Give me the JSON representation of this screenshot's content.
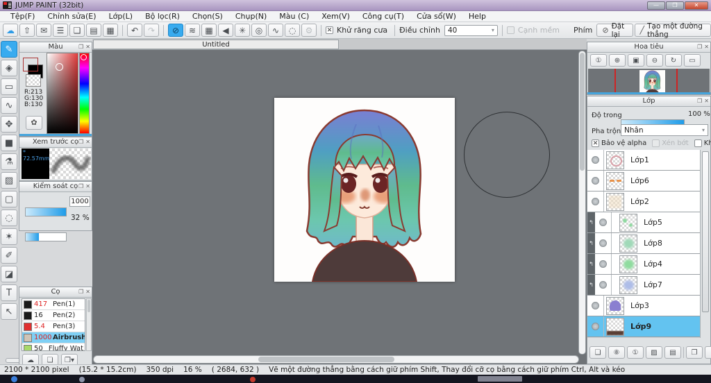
{
  "window": {
    "title": "JUMP PAINT (32bit)",
    "minimize": "—",
    "restore": "❐",
    "close": "✕"
  },
  "menubar": {
    "items": [
      "Tệp(F)",
      "Chỉnh sửa(E)",
      "Lớp(L)",
      "Bộ lọc(R)",
      "Chọn(S)",
      "Chụp(N)",
      "Màu (C)",
      "Xem(V)",
      "Công cụ(T)",
      "Cửa sổ(W)",
      "Help"
    ]
  },
  "toolbar": {
    "file_group": [
      {
        "n": "cloud-sync-button",
        "g": "☁",
        "c": "#2e9be6"
      },
      {
        "n": "export-button",
        "g": "⇧"
      },
      {
        "n": "comment-button",
        "g": "✉"
      },
      {
        "n": "chat-button",
        "g": "☰"
      },
      {
        "n": "document-button",
        "g": "❏"
      },
      {
        "n": "material-panel-button",
        "g": "▤"
      },
      {
        "n": "pixel-edit-button",
        "g": "▦"
      }
    ],
    "undo_group": [
      {
        "n": "undo-button",
        "g": "↶"
      },
      {
        "n": "redo-button",
        "g": "↷",
        "dis": true
      }
    ],
    "ruler_group": [
      {
        "n": "ruler-off-button",
        "g": "⊘",
        "sel": true
      },
      {
        "n": "parallel-ruler-button",
        "g": "≋"
      },
      {
        "n": "grid-ruler-button",
        "g": "▦"
      },
      {
        "n": "vanishing-ruler-button",
        "g": "◀"
      },
      {
        "n": "radial-ruler-button",
        "g": "✳"
      },
      {
        "n": "concentric-ruler-button",
        "g": "◎"
      },
      {
        "n": "curve-ruler-button",
        "g": "∿"
      },
      {
        "n": "ellipse-ruler-button",
        "g": "◌"
      },
      {
        "n": "ruler-settings-button",
        "g": "⚙",
        "dis": true
      }
    ],
    "antialias_label": "Khử răng cưa",
    "adjust_label": "Điều chỉnh",
    "adjust_value": "40",
    "soft_edge_label": "Cạnh mềm",
    "key_label": "Phím",
    "reset_button_label": "Đặt lại",
    "reset_button_glyph": "⊘",
    "line_button_label": "Tạo một đường thẳng",
    "line_button_glyph": "╱"
  },
  "tools": [
    {
      "n": "brush-tool",
      "g": "✎",
      "sel": true
    },
    {
      "n": "eraser-tool",
      "g": "◈"
    },
    {
      "n": "figure-tool",
      "g": "▭"
    },
    {
      "n": "snap-curve-tool",
      "g": "∿"
    },
    {
      "n": "move-tool",
      "g": "✥"
    },
    {
      "n": "fill-rect-tool",
      "g": "■"
    },
    {
      "n": "bucket-tool",
      "g": "⚗"
    },
    {
      "n": "gradient-tool",
      "g": "▨"
    },
    {
      "n": "select-rect-tool",
      "g": "▢"
    },
    {
      "n": "lasso-tool",
      "g": "◌"
    },
    {
      "n": "magic-wand-tool",
      "g": "✶"
    },
    {
      "n": "select-pen-tool",
      "g": "✐"
    },
    {
      "n": "select-eraser-tool",
      "g": "◪"
    },
    {
      "n": "text-tool",
      "g": "T"
    },
    {
      "n": "operate-tool",
      "g": "↖"
    }
  ],
  "panel_icons": {
    "popout": "❐",
    "close": "✕"
  },
  "color_panel": {
    "title": "Màu",
    "fg_color": "#d58282",
    "bg_color": "#000000",
    "rgb": [
      "R:213",
      "G:130",
      "B:130"
    ],
    "palette_glyph": "✿"
  },
  "brush_preview": {
    "title": "Xem trước cọ",
    "size_marker": "*",
    "size_text": "72.57mm"
  },
  "brush_control": {
    "title": "Kiểm soát cọ",
    "size_value": "1000",
    "size_percent": 100,
    "opacity_value": "32 %",
    "opacity_percent": 32
  },
  "brush_panel": {
    "title": "Cọ",
    "brushes": [
      {
        "color": "#1a1a1a",
        "size": "417",
        "red": true,
        "name": "Pen(1)"
      },
      {
        "color": "#1a1a1a",
        "size": "16",
        "red": false,
        "name": "Pen(2)"
      },
      {
        "color": "#e03030",
        "size": "5.4",
        "red": true,
        "name": "Pen(3)"
      },
      {
        "color": "#cfc4b6",
        "size": "1000",
        "red": true,
        "name": "Airbrush",
        "sel": true
      },
      {
        "color": "#a8d96a",
        "size": "50",
        "red": false,
        "name": "Fluffy Wat"
      }
    ],
    "buttons": [
      {
        "n": "brush-cloud-download-button",
        "g": "☁"
      },
      {
        "n": "brush-new-button",
        "g": "❏"
      },
      {
        "n": "brush-save-button",
        "g": "❒▾"
      }
    ]
  },
  "navigator": {
    "title": "Hoa tiêu",
    "buttons": [
      {
        "n": "zoom-actual-button",
        "g": "①"
      },
      {
        "n": "zoom-in-button",
        "g": "⊕"
      },
      {
        "n": "fit-screen-button",
        "g": "▣"
      },
      {
        "n": "zoom-out-button",
        "g": "⊖"
      },
      {
        "n": "rotate-view-button",
        "g": "↻"
      },
      {
        "n": "reset-view-button",
        "g": "▭"
      }
    ]
  },
  "layer_panel": {
    "title": "Lớp",
    "opacity_label": "Độ trong",
    "opacity_value": "100 %",
    "blend_label": "Pha trộn",
    "blend_value": "Nhân",
    "alpha_label": "Bảo vệ alpha",
    "clip_label": "Xén bớt",
    "lock_label": "Khóa",
    "clip_glyph": "↰",
    "layers": [
      {
        "name": "Lớp1",
        "shape": "scribble",
        "color": "#d9a0a8"
      },
      {
        "name": "Lớp6",
        "shape": "dashes",
        "color": "#e8924a"
      },
      {
        "name": "Lớp2",
        "shape": "wash",
        "color": "#f2dfc2"
      },
      {
        "name": "Lớp5",
        "shape": "dots",
        "color": "#8fd9a0",
        "clipped": true
      },
      {
        "name": "Lớp8",
        "shape": "blob",
        "color": "#a0d9b8",
        "clipped": true
      },
      {
        "name": "Lớp4",
        "shape": "blob",
        "color": "#8fdc9f",
        "clipped": true
      },
      {
        "name": "Lớp7",
        "shape": "blob",
        "color": "#aebde8",
        "clipped": true
      },
      {
        "name": "Lớp3",
        "shape": "arch",
        "color": "#8a7fd0"
      },
      {
        "name": "Lớp9",
        "shape": "strip",
        "color": "#5a3f35",
        "sel": true
      }
    ],
    "buttons": [
      {
        "n": "add-layer-button",
        "g": "❏"
      },
      {
        "n": "add-8bit-layer-button",
        "g": "⑧"
      },
      {
        "n": "add-1bit-layer-button",
        "g": "①"
      },
      {
        "n": "add-tone-layer-button",
        "g": "▨"
      },
      {
        "n": "add-folder-button",
        "g": "▤"
      },
      {
        "n": "duplicate-layer-button",
        "g": "❐"
      },
      {
        "n": "merge-layer-button",
        "g": "⇩"
      }
    ]
  },
  "canvas": {
    "tab_label": "Untitled"
  },
  "statusbar": {
    "parts": [
      "2100 * 2100 pixel",
      "(15.2 * 15.2cm)",
      "350 dpi",
      "16 %",
      "( 2684, 632 )",
      "Vẽ một đường thẳng bằng cách giữ phím Shift, Thay đổi cỡ cọ bằng cách giữ phím Ctrl, Alt và kéo"
    ]
  }
}
